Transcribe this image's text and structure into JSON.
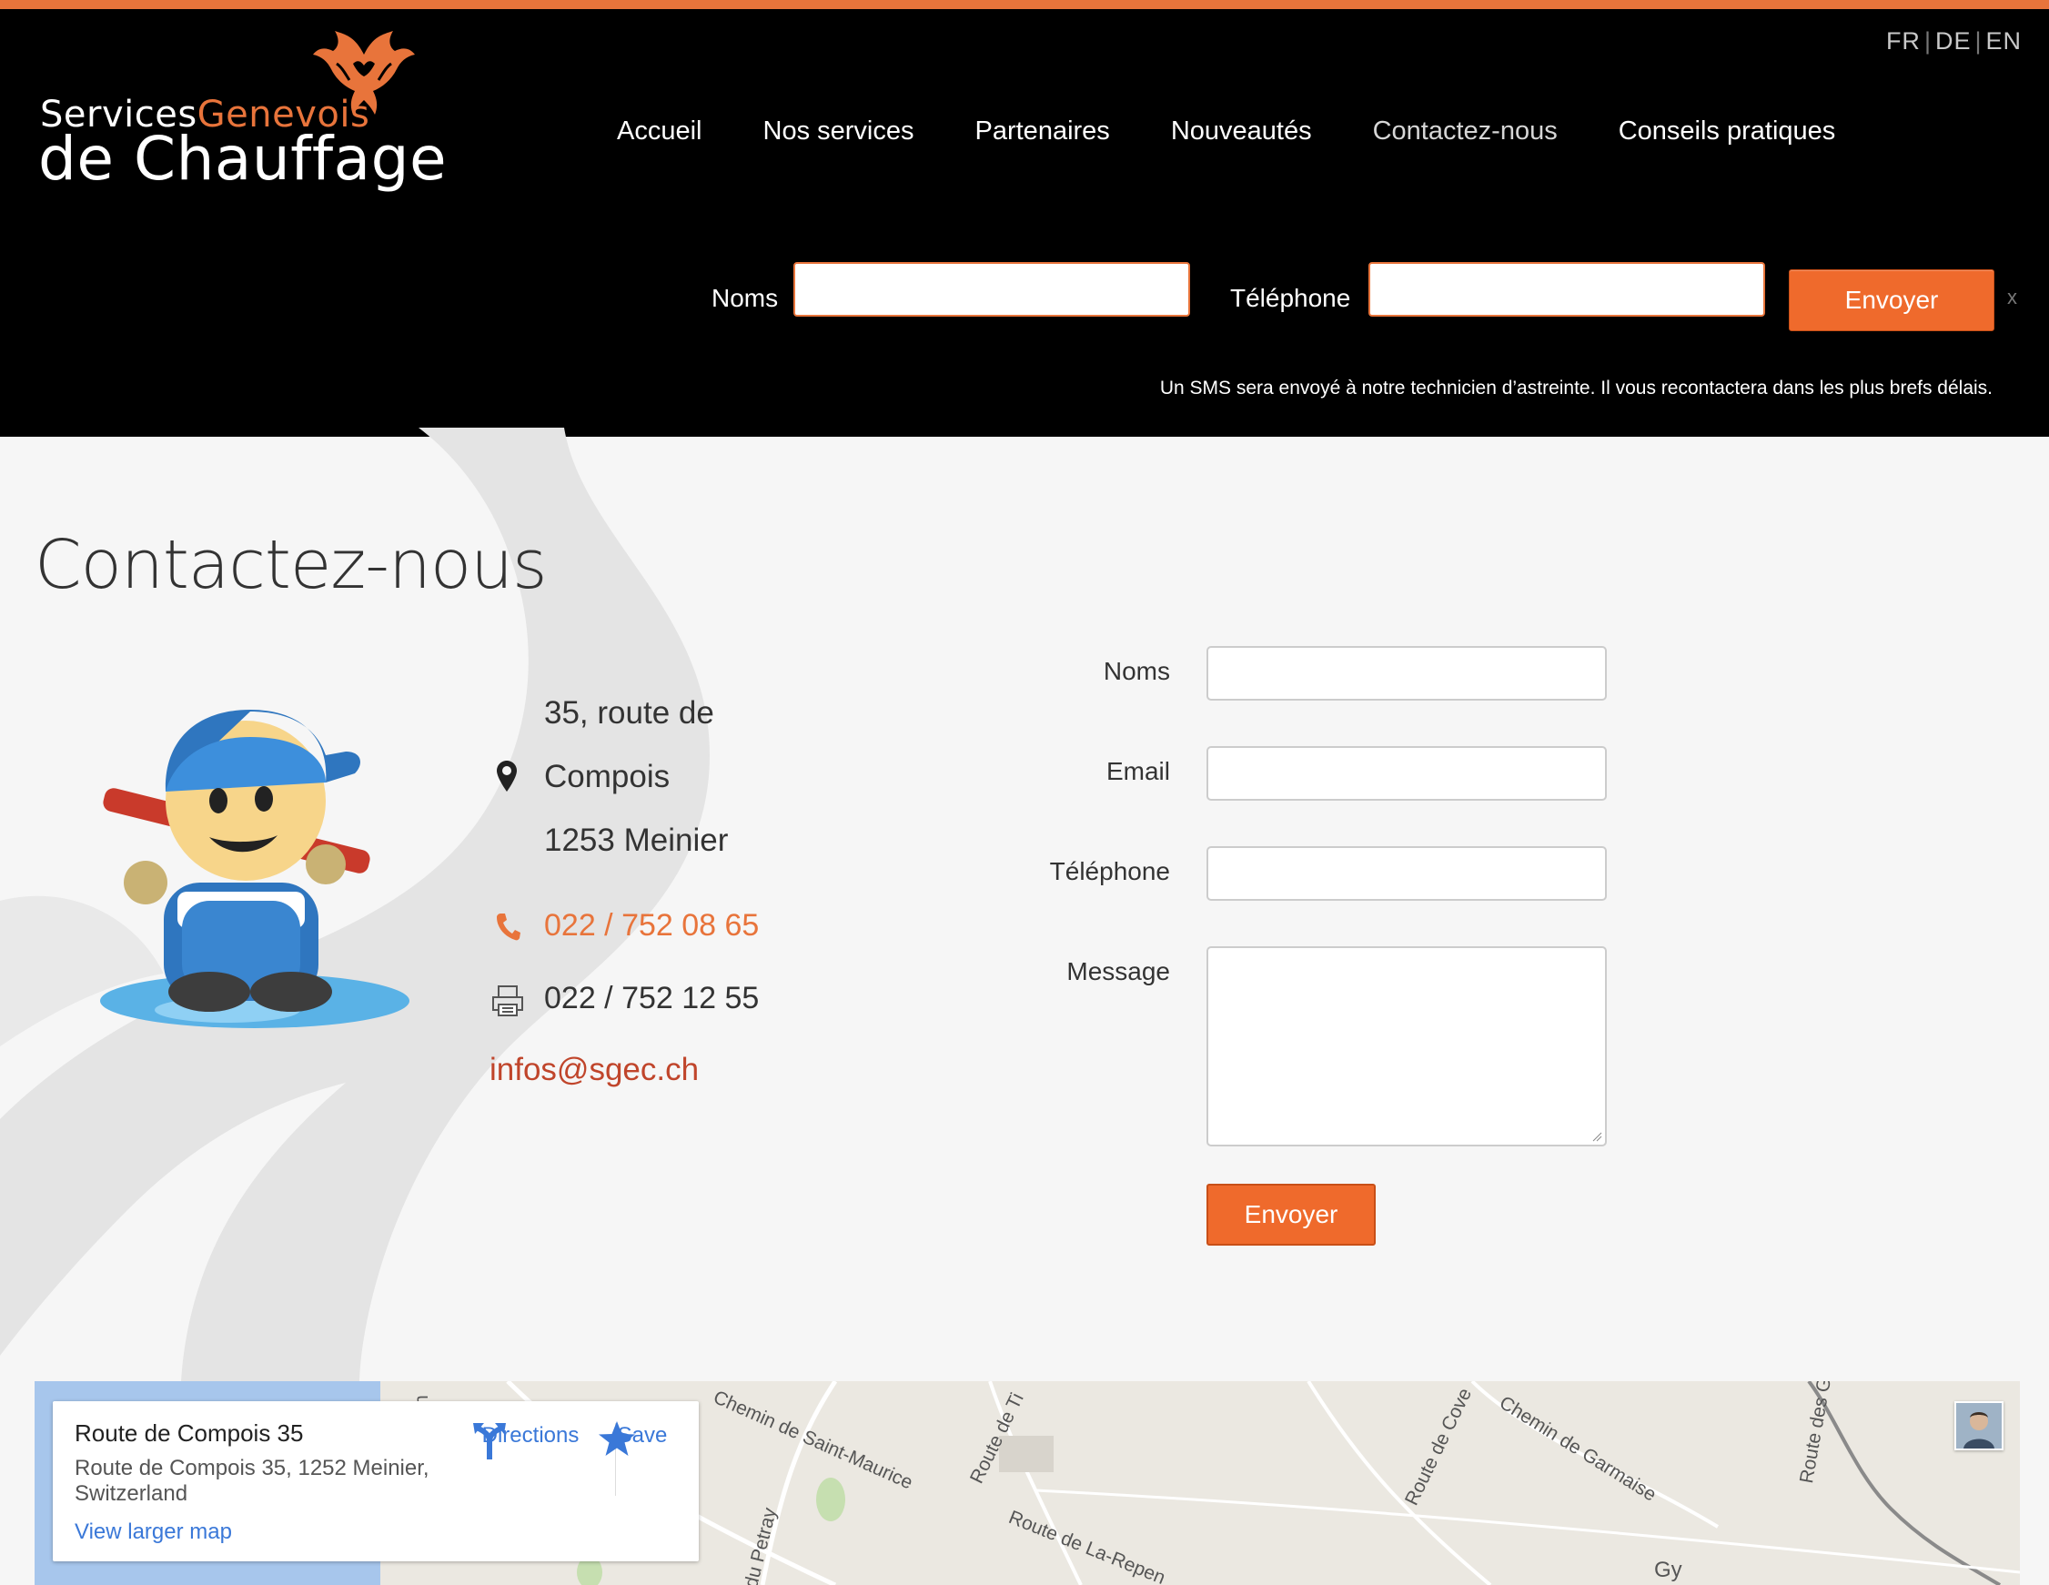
{
  "header": {
    "logo": {
      "word1": "Services",
      "word2": "Genevois",
      "line2": "de Chauffage"
    },
    "languages": [
      "FR",
      "DE",
      "EN"
    ],
    "nav": [
      {
        "label": "Accueil"
      },
      {
        "label": "Nos services"
      },
      {
        "label": "Partenaires"
      },
      {
        "label": "Nouveautés"
      },
      {
        "label": "Contactez-nous",
        "active": true
      },
      {
        "label": "Conseils pratiques"
      }
    ],
    "callback": {
      "name_label": "Noms",
      "phone_label": "Téléphone",
      "submit_label": "Envoyer",
      "close_label": "x",
      "note": "Un SMS sera envoyé à notre technicien d’astreinte. Il vous recontactera dans les plus brefs délais."
    }
  },
  "main": {
    "title": "Contactez-nous",
    "address": {
      "line1": "35, route de",
      "line2": "Compois",
      "line3": "1253 Meinier"
    },
    "phone": "022 / 752 08 65",
    "fax": "022 / 752 12 55",
    "email": "infos@sgec.ch",
    "form": {
      "name_label": "Noms",
      "email_label": "Email",
      "phone_label": "Téléphone",
      "message_label": "Message",
      "submit_label": "Envoyer"
    }
  },
  "map": {
    "card": {
      "title": "Route de Compois 35",
      "address": "Route de Compois 35, 1252 Meinier, Switzerland",
      "larger_map": "View larger map",
      "directions": "Directions",
      "save": "Save"
    },
    "labels": {
      "l1": "Chemin de Saint-Maurice",
      "l2": "Route de Ti",
      "l3": "Route de La-Repen",
      "l4": "Route de Cove",
      "l5": "Chemin de Garmaise",
      "l6": "Route des Gr",
      "l7": "Gy",
      "l8": "du Petray",
      "l9": "Ch"
    }
  },
  "colors": {
    "accent": "#e8743b",
    "header_bg": "#000000",
    "email": "#c0452b",
    "link": "#3a78d8"
  }
}
